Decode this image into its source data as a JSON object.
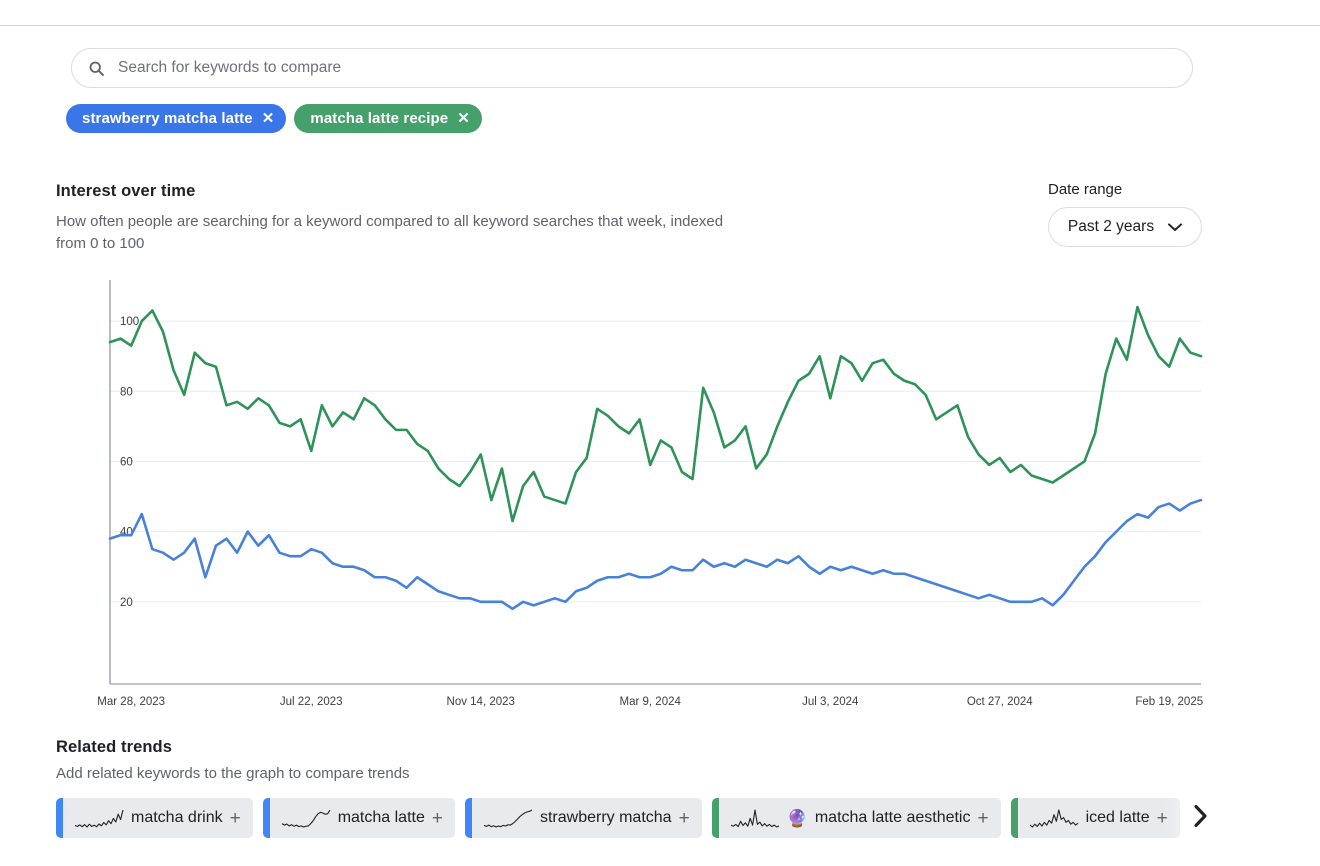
{
  "search": {
    "placeholder": "Search for keywords to compare",
    "value": "",
    "icon": "search-icon"
  },
  "keyword_chips": [
    {
      "label": "strawberry matcha latte",
      "color": "#3A76E8",
      "remove": "✕"
    },
    {
      "label": "matcha latte recipe",
      "color": "#45A06B",
      "remove": "✕"
    }
  ],
  "interest_section": {
    "title": "Interest over time",
    "subtitle": "How often people are searching for a keyword compared to all keyword searches that week, indexed from 0 to 100"
  },
  "date_range": {
    "label": "Date range",
    "selected": "Past 2 years",
    "chevron": "chevron-down-icon",
    "options": [
      "Past 2 years"
    ]
  },
  "related_section": {
    "title": "Related trends",
    "subtitle": "Add related keywords to the graph to compare trends",
    "next_arrow": "chevron-right-icon"
  },
  "related_chips": [
    {
      "label": "matcha drink",
      "color": "#4285F4",
      "plus": "+",
      "emoji": "",
      "spark": [
        10,
        7,
        12,
        6,
        13,
        5,
        14,
        7,
        11,
        6,
        15,
        9,
        20,
        12,
        26,
        16,
        34,
        22,
        48,
        30,
        62
      ]
    },
    {
      "label": "matcha latte",
      "color": "#4285F4",
      "plus": "+",
      "emoji": "",
      "spark": [
        22,
        18,
        21,
        16,
        19,
        15,
        18,
        14,
        16,
        13,
        15,
        16,
        22,
        30,
        40,
        48,
        52,
        50,
        47,
        48,
        58
      ]
    },
    {
      "label": "strawberry matcha",
      "color": "#4285F4",
      "plus": "+",
      "emoji": "",
      "spark": [
        16,
        13,
        17,
        12,
        15,
        11,
        14,
        12,
        16,
        14,
        18,
        17,
        22,
        28,
        36,
        44,
        50,
        55,
        58,
        60,
        64
      ]
    },
    {
      "label": "matcha latte aesthetic",
      "color": "#45A06B",
      "plus": "+",
      "emoji": "🔮",
      "spark": [
        12,
        9,
        14,
        8,
        22,
        11,
        18,
        9,
        30,
        12,
        52,
        14,
        20,
        10,
        16,
        9,
        14,
        8,
        12,
        7,
        10
      ]
    },
    {
      "label": "iced latte",
      "color": "#45A06B",
      "plus": "+",
      "emoji": "",
      "spark": [
        14,
        10,
        16,
        11,
        18,
        12,
        20,
        14,
        24,
        18,
        36,
        22,
        46,
        26,
        30,
        20,
        24,
        16,
        20,
        14,
        18
      ]
    }
  ],
  "chart_data": {
    "type": "line",
    "title": "Interest over time",
    "xlabel": "",
    "ylabel": "",
    "ylim": [
      0,
      110
    ],
    "yticks": [
      20,
      40,
      60,
      80,
      100
    ],
    "grid": true,
    "legend": "none",
    "x_tick_labels": [
      "Mar 28, 2023",
      "Jul 22, 2023",
      "Nov 14, 2023",
      "Mar 9, 2024",
      "Jul 3, 2024",
      "Oct 27, 2024",
      "Feb 19, 2025"
    ],
    "x_tick_indices": [
      2,
      19,
      35,
      51,
      68,
      84,
      100
    ],
    "n_points": 104,
    "series": [
      {
        "name": "matcha latte recipe",
        "color": "#2E9358",
        "values": [
          94,
          95,
          93,
          100,
          103,
          97,
          86,
          79,
          91,
          88,
          87,
          76,
          77,
          75,
          78,
          76,
          71,
          70,
          72,
          63,
          76,
          70,
          74,
          72,
          78,
          76,
          72,
          69,
          69,
          65,
          63,
          58,
          55,
          53,
          57,
          62,
          49,
          58,
          43,
          53,
          57,
          50,
          49,
          48,
          57,
          61,
          75,
          73,
          70,
          68,
          72,
          59,
          66,
          64,
          57,
          55,
          81,
          74,
          64,
          66,
          70,
          58,
          62,
          70,
          77,
          83,
          85,
          90,
          78,
          90,
          88,
          83,
          88,
          89,
          85,
          83,
          82,
          79,
          72,
          74,
          76,
          67,
          62,
          59,
          61,
          57,
          59,
          56,
          55,
          54,
          56,
          58,
          60,
          68,
          85,
          95,
          89,
          104,
          96,
          90,
          87,
          95,
          91,
          90
        ]
      },
      {
        "name": "strawberry matcha latte",
        "color": "#4781D9",
        "values": [
          38,
          39,
          39,
          45,
          35,
          34,
          32,
          34,
          38,
          27,
          36,
          38,
          34,
          40,
          36,
          39,
          34,
          33,
          33,
          35,
          34,
          31,
          30,
          30,
          29,
          27,
          27,
          26,
          24,
          27,
          25,
          23,
          22,
          21,
          21,
          20,
          20,
          20,
          18,
          20,
          19,
          20,
          21,
          20,
          23,
          24,
          26,
          27,
          27,
          28,
          27,
          27,
          28,
          30,
          29,
          29,
          32,
          30,
          31,
          30,
          32,
          31,
          30,
          32,
          31,
          33,
          30,
          28,
          30,
          29,
          30,
          29,
          28,
          29,
          28,
          28,
          27,
          26,
          25,
          24,
          23,
          22,
          21,
          22,
          21,
          20,
          20,
          20,
          21,
          19,
          22,
          26,
          30,
          33,
          37,
          40,
          43,
          45,
          44,
          47,
          48,
          46,
          48,
          49
        ]
      }
    ]
  }
}
